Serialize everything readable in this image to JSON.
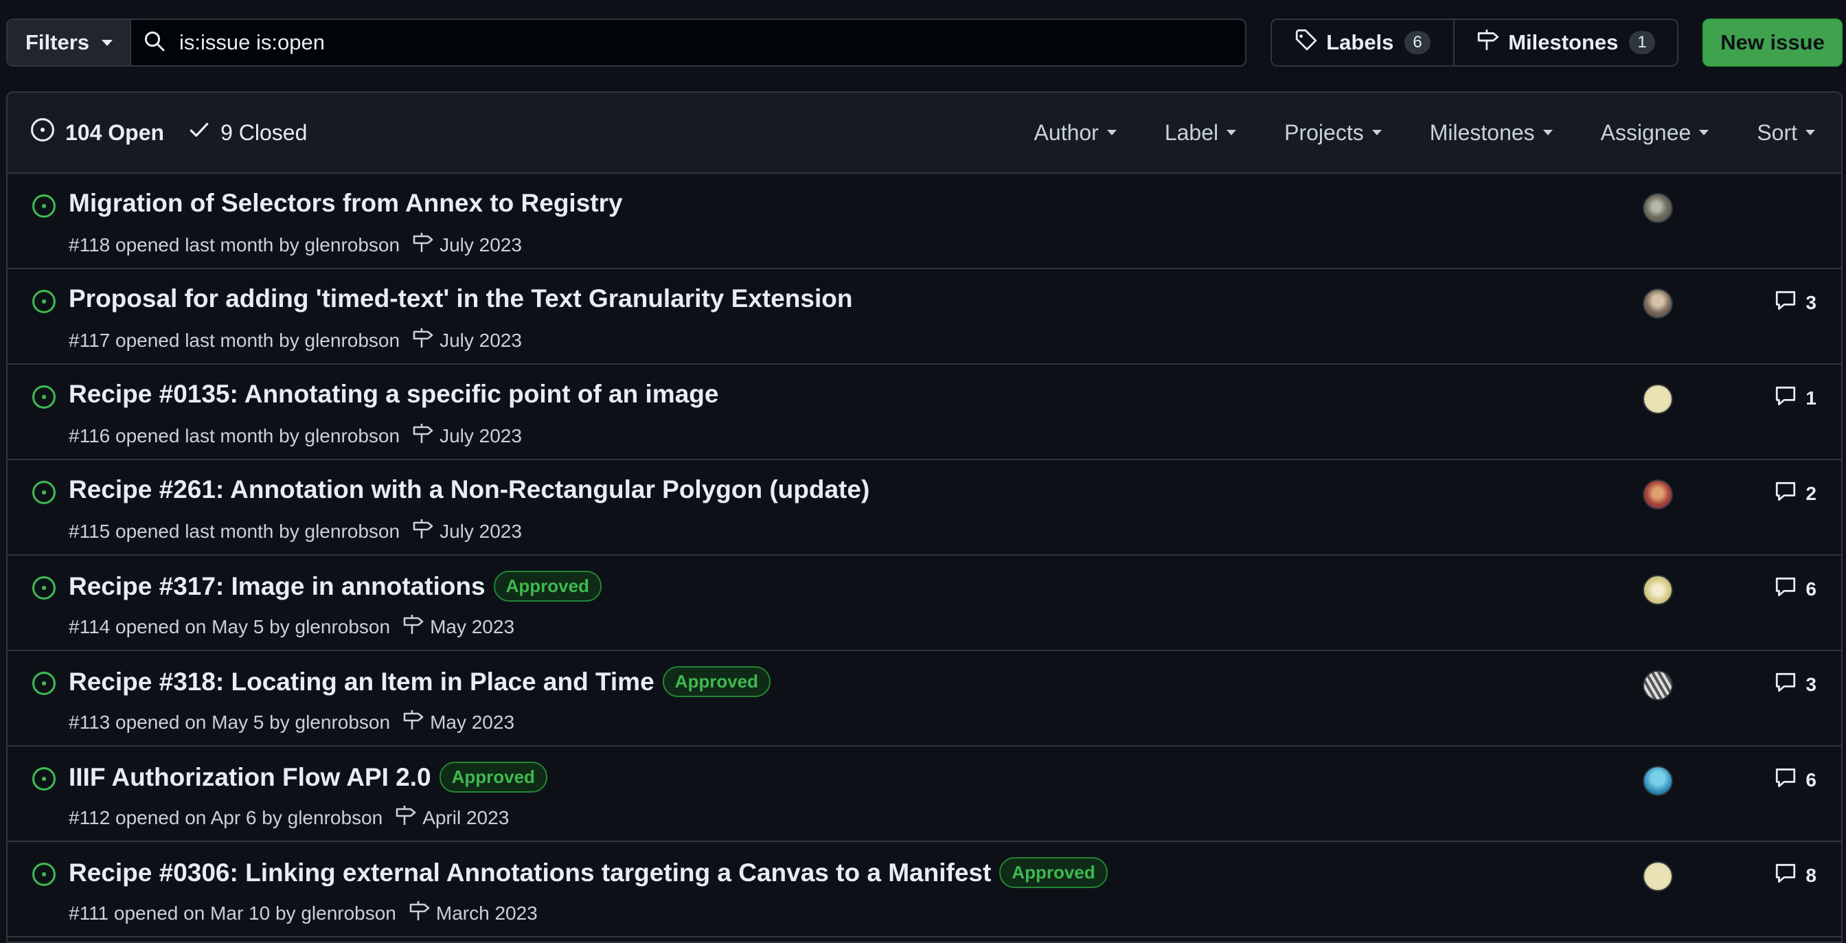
{
  "toolbar": {
    "filters_label": "Filters",
    "search_value": "is:issue is:open",
    "labels_label": "Labels",
    "labels_count": "6",
    "milestones_label": "Milestones",
    "milestones_count": "1",
    "new_issue_label": "New issue"
  },
  "header": {
    "open_label": "104 Open",
    "closed_label": "9 Closed",
    "filters": [
      "Author",
      "Label",
      "Projects",
      "Milestones",
      "Assignee",
      "Sort"
    ]
  },
  "colors": {
    "open": "#3fb950",
    "accent_button": "#3fa34d",
    "border": "#30363d"
  },
  "issues": [
    {
      "title": "Migration of Selectors from Annex to Registry",
      "meta": "#118 opened last month by glenrobson",
      "milestone": "July 2023",
      "label": "",
      "comments": ""
    },
    {
      "title": "Proposal for adding 'timed-text' in the Text Granularity Extension",
      "meta": "#117 opened last month by glenrobson",
      "milestone": "July 2023",
      "label": "",
      "comments": "3"
    },
    {
      "title": "Recipe #0135: Annotating a specific point of an image",
      "meta": "#116 opened last month by glenrobson",
      "milestone": "July 2023",
      "label": "",
      "comments": "1"
    },
    {
      "title": "Recipe #261: Annotation with a Non-Rectangular Polygon (update)",
      "meta": "#115 opened last month by glenrobson",
      "milestone": "July 2023",
      "label": "",
      "comments": "2"
    },
    {
      "title": "Recipe #317: Image in annotations",
      "meta": "#114 opened on May 5 by glenrobson",
      "milestone": "May 2023",
      "label": "Approved",
      "comments": "6"
    },
    {
      "title": "Recipe #318: Locating an Item in Place and Time",
      "meta": "#113 opened on May 5 by glenrobson",
      "milestone": "May 2023",
      "label": "Approved",
      "comments": "3"
    },
    {
      "title": "IIIF Authorization Flow API 2.0",
      "meta": "#112 opened on Apr 6 by glenrobson",
      "milestone": "April 2023",
      "label": "Approved",
      "comments": "6"
    },
    {
      "title": "Recipe #0306: Linking external Annotations targeting a Canvas to a Manifest",
      "meta": "#111 opened on Mar 10 by glenrobson",
      "milestone": "March 2023",
      "label": "Approved",
      "comments": "8"
    }
  ]
}
